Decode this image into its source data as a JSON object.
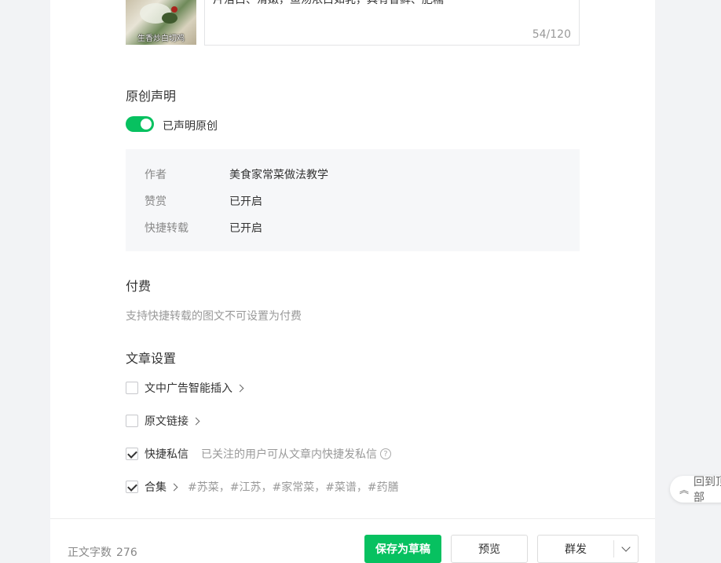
{
  "excerpt": {
    "cover_caption": "生香炒白切鸡",
    "text": "片洁白、滑嫩，鱼汤浓白如乳，具有香鲜、肥糯",
    "count": "54/120"
  },
  "original": {
    "title": "原创声明",
    "toggle_label": "已声明原创",
    "toggle_on": true,
    "rows": [
      {
        "key": "作者",
        "value": "美食家常菜做法教学"
      },
      {
        "key": "赞赏",
        "value": "已开启"
      },
      {
        "key": "快捷转载",
        "value": "已开启"
      }
    ]
  },
  "paid": {
    "title": "付费",
    "hint": "支持快捷转载的图文不可设置为付费"
  },
  "settings": {
    "title": "文章设置",
    "items": [
      {
        "label": "文中广告智能插入",
        "checked": false,
        "desc": ""
      },
      {
        "label": "原文链接",
        "checked": false,
        "desc": ""
      },
      {
        "label": "快捷私信",
        "checked": true,
        "desc": "已关注的用户可从文章内快捷发私信"
      },
      {
        "label": "合集",
        "checked": true,
        "desc": "#苏菜，#江苏，#家常菜，#菜谱，#药膳"
      }
    ]
  },
  "back_to_top": "回到顶部",
  "footer": {
    "word_count_label": "正文字数",
    "word_count": "276",
    "save_draft": "保存为草稿",
    "preview": "预览",
    "publish": "群发"
  },
  "colors": {
    "accent": "#07c160",
    "page_bg": "#f2f3f5",
    "info_bg": "#f6f7f9"
  }
}
